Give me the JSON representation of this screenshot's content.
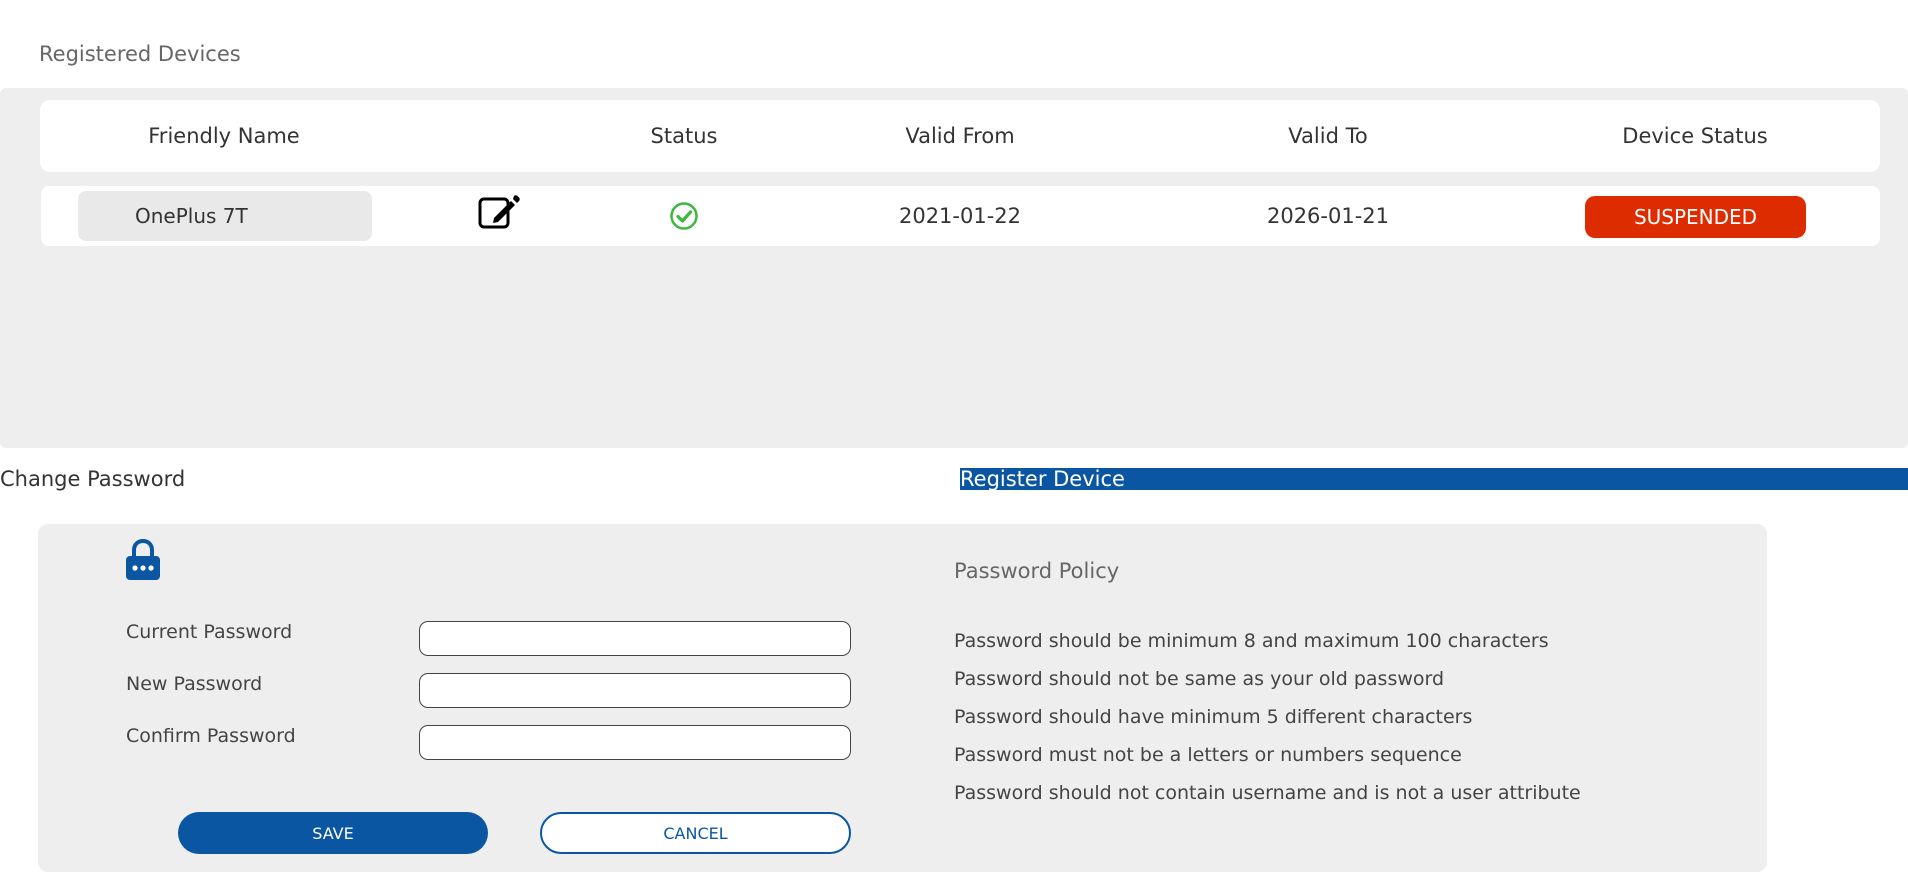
{
  "devices": {
    "title": "Registered Devices",
    "columns": [
      "Friendly Name",
      "Status",
      "Valid From",
      "Valid To",
      "Device Status"
    ],
    "rows": [
      {
        "friendly_name": "OnePlus 7T",
        "status_icon": "check-circle-icon",
        "valid_from": "2021-01-22",
        "valid_to": "2026-01-21",
        "device_status": "SUSPENDED"
      }
    ]
  },
  "tabs": {
    "change_password": "Change Password",
    "register_device": "Register Device"
  },
  "password_form": {
    "lock_icon": "lock-icon",
    "current_label": "Current Password",
    "new_label": "New Password",
    "confirm_label": "Confirm Password",
    "current_value": "",
    "new_value": "",
    "confirm_value": "",
    "save_label": "SAVE",
    "cancel_label": "CANCEL"
  },
  "policy": {
    "title": "Password Policy",
    "rules": [
      "Password should be minimum 8 and maximum 100 characters",
      "Password should not be same as your old password",
      "Password should have minimum 5 different characters",
      "Password must not be a letters or numbers sequence",
      "Password should not contain username and is not a user attribute"
    ]
  },
  "colors": {
    "primary": "#0a56a3",
    "danger": "#dd2c00",
    "success": "#3cb83c",
    "panel_bg": "#eeeeee"
  }
}
